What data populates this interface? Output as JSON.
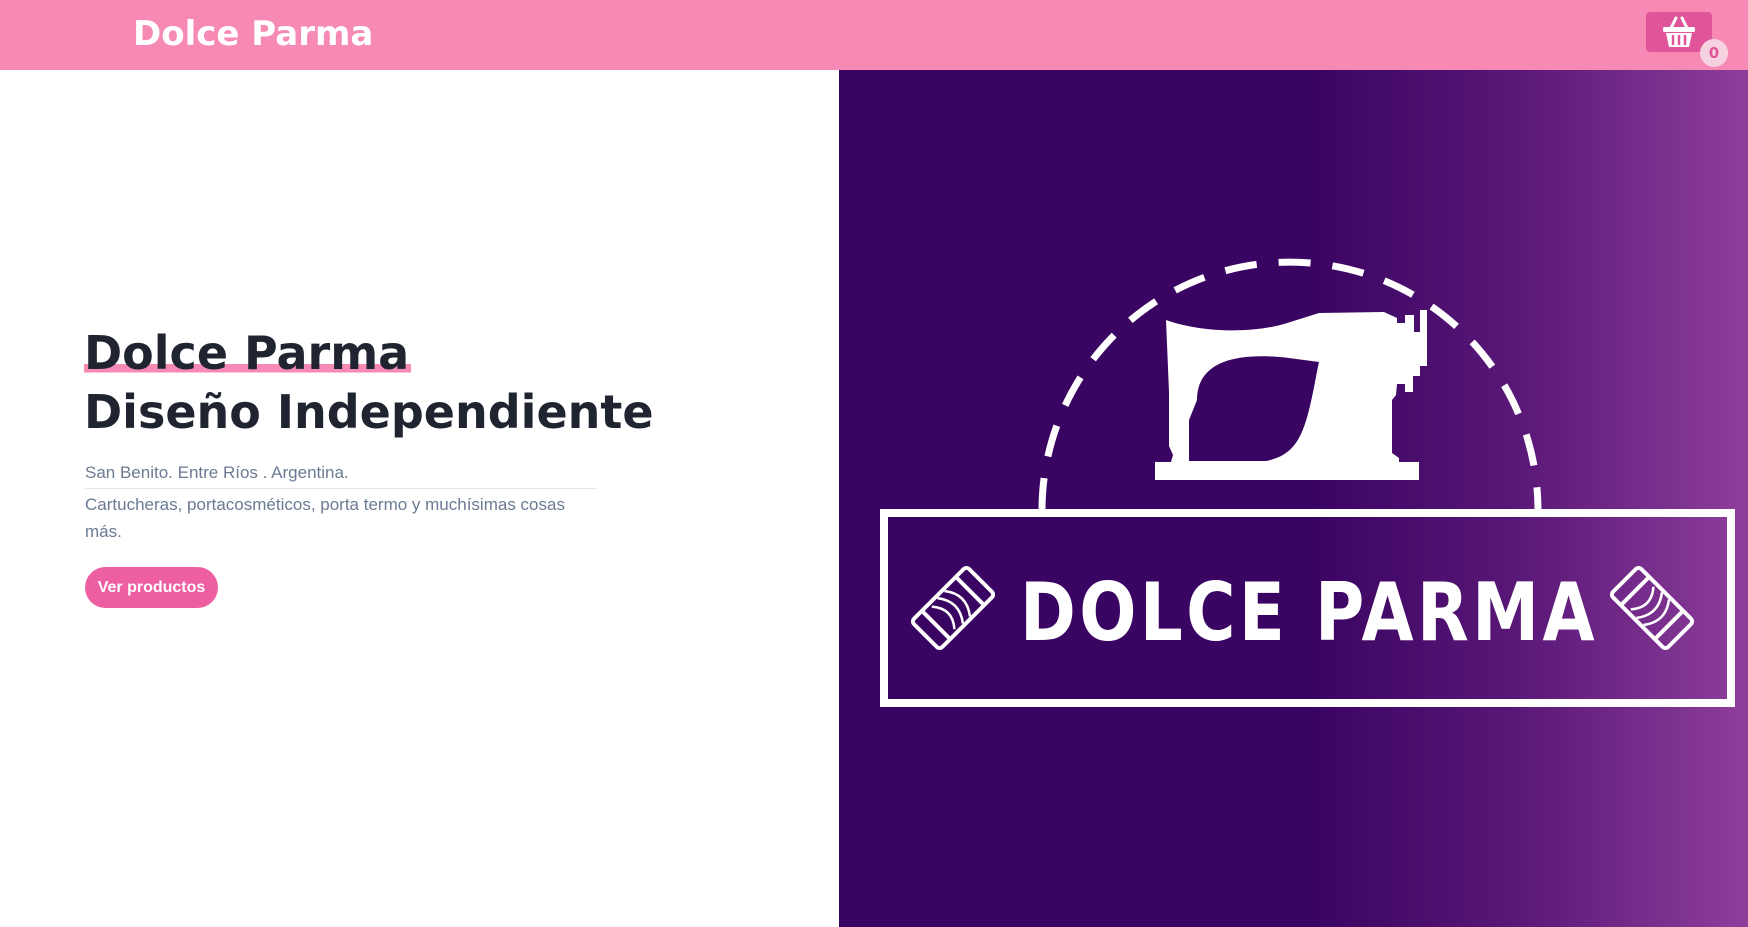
{
  "header": {
    "brand": "Dolce Parma",
    "cart_icon": "basket-icon",
    "cart_count": "0",
    "colors": {
      "bar": "#f78ab4",
      "cart_button": "#e0559a"
    }
  },
  "hero": {
    "title_line1": "Dolce Parma",
    "title_line2": "Diseño Independiente",
    "location": "San Benito. Entre Ríos . Argentina.",
    "description": "Cartucheras, portacosméticos, porta termo y muchísimas cosas más.",
    "cta_label": "Ver productos",
    "colors": {
      "accent": "#ee5fa2",
      "title": "#1f2430",
      "muted": "#6b7a93"
    }
  },
  "logo_image": {
    "icon": "sewing-machine-icon",
    "wordmark": "DOLCE PARMA",
    "side_icons": [
      "thread-spool-icon",
      "thread-spool-icon"
    ],
    "colors": {
      "background_start": "#3a0462",
      "background_end": "#8e3e9b",
      "foreground": "#ffffff"
    }
  }
}
